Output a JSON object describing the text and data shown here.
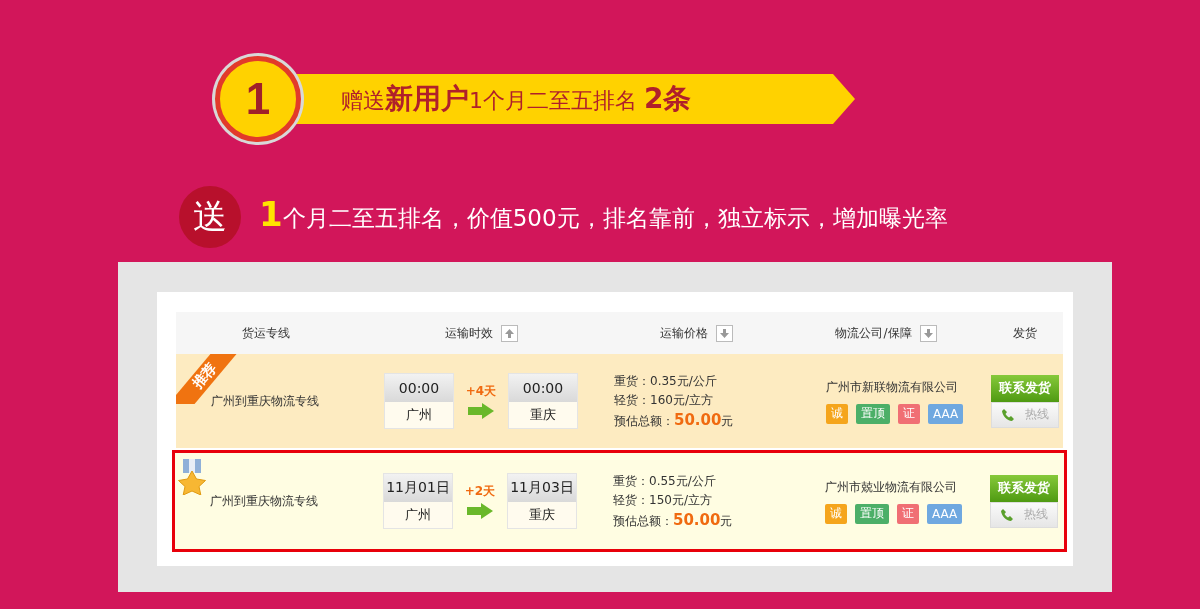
{
  "banner": {
    "number": "1",
    "title": "赠送**新用户**1个月二至五排名 **2条**"
  },
  "offer": {
    "badge": "送",
    "lead": "1",
    "text": "个月二至五排名，价值500元，排名靠前，独立标示，增加曝光率"
  },
  "table": {
    "columns": [
      {
        "label": "货运专线",
        "sortable": false
      },
      {
        "label": "运输时效",
        "sortable": true,
        "descending": false
      },
      {
        "label": "运输价格",
        "sortable": true,
        "descending": true
      },
      {
        "label": "物流公司/保障",
        "sortable": true,
        "descending": true
      },
      {
        "label": "发货",
        "sortable": false
      }
    ],
    "rows": [
      {
        "selected": false,
        "badge": {
          "kind": "ribbon",
          "label": "推荐"
        },
        "route": "广州到重庆物流专线",
        "depart": {
          "time": "00:00",
          "city": "广州"
        },
        "duration": "+4天",
        "arrive": {
          "time": "00:00",
          "city": "重庆"
        },
        "heavy": "重货：0.35元/公斤",
        "light": "轻货：160元/立方",
        "total_label": "预估总额：",
        "total": "50.00",
        "total_unit": "元",
        "company": "广州市新联物流有限公司",
        "tags": [
          {
            "label": "诚",
            "color": "#f5a51c"
          },
          {
            "label": "置顶",
            "color": "#4caf68"
          },
          {
            "label": "证",
            "color": "#f06f74"
          },
          {
            "label": "AAA",
            "color": "#6fa8e0"
          }
        ],
        "contact": "联系发货",
        "hotline": "热线"
      },
      {
        "selected": true,
        "badge": {
          "kind": "medal"
        },
        "route": "广州到重庆物流专线",
        "depart": {
          "time": "11月01日",
          "city": "广州"
        },
        "duration": "+2天",
        "arrive": {
          "time": "11月03日",
          "city": "重庆"
        },
        "heavy": "重货：0.55元/公斤",
        "light": "轻货：150元/立方",
        "total_label": "预估总额：",
        "total": "50.00",
        "total_unit": "元",
        "company": "广州市兢业物流有限公司",
        "tags": [
          {
            "label": "诚",
            "color": "#f5a51c"
          },
          {
            "label": "置顶",
            "color": "#4caf68"
          },
          {
            "label": "证",
            "color": "#f06f74"
          },
          {
            "label": "AAA",
            "color": "#6fa8e0"
          }
        ],
        "contact": "联系发货",
        "hotline": "热线"
      }
    ]
  }
}
